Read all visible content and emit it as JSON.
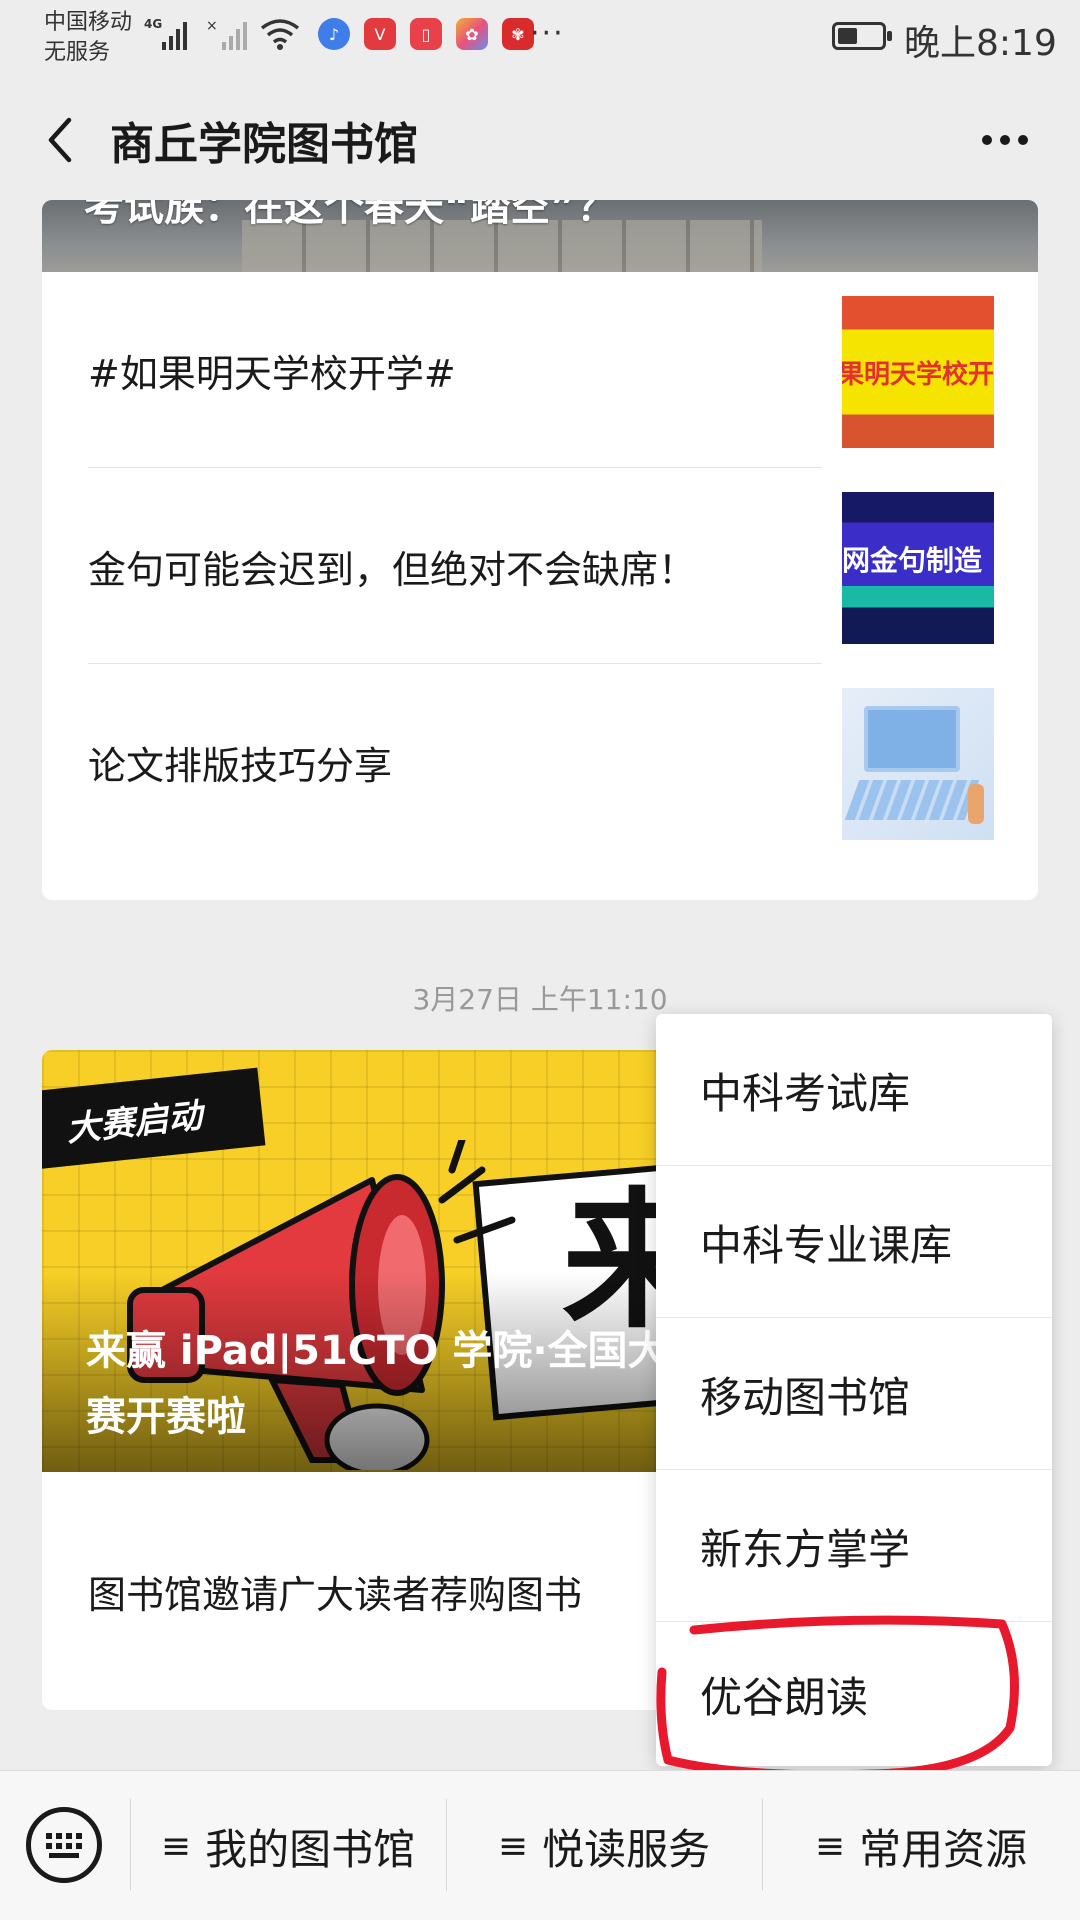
{
  "status_bar": {
    "carrier_line1": "中国移动",
    "carrier_line2": "无服务",
    "network": "4G",
    "time": "晚上8:19",
    "battery_level": 0.45,
    "overflow": "···",
    "app_icons": [
      "music-app-icon",
      "vmall-app-icon",
      "reader-app-icon",
      "gallery-app-icon",
      "huawei-app-icon"
    ]
  },
  "nav": {
    "title": "商丘学院图书馆"
  },
  "article_card_1": {
    "hero_title": "考试族：在这个春天“踏空”？",
    "items": [
      {
        "title": "#如果明天学校开学#",
        "thumb_text": "果明天学校开"
      },
      {
        "title": "金句可能会迟到，但绝对不会缺席！",
        "thumb_text": "网金句制造"
      },
      {
        "title": "论文排版技巧分享"
      }
    ]
  },
  "timestamp": "3月27日 上午11:10",
  "article_card_2": {
    "badge": "大赛启动",
    "hero_title": "来赢 iPad|51CTO 学院·全国大学生…赛开赛啦",
    "hero_title_line1": "来赢 iPad|51CTO 学院·全国大",
    "hero_title_line2": "赛开赛啦",
    "panel_char": "来",
    "items": [
      {
        "title": "图书馆邀请广大读者荐购图书"
      }
    ]
  },
  "popup_menu": {
    "items": [
      "中科考试库",
      "中科专业课库",
      "移动图书馆",
      "新东方掌学",
      "优谷朗读"
    ],
    "highlighted_item": "优谷朗读",
    "highlight_color": "#e8192c"
  },
  "bottom_menu": {
    "keyboard_icon": "keyboard-icon",
    "items": [
      "我的图书馆",
      "悦读服务",
      "常用资源"
    ],
    "item_icon": "≡"
  },
  "colors": {
    "background": "#ededed",
    "card": "#ffffff",
    "hero2_yellow": "#f7cf26",
    "megaphone_red": "#e23a3f"
  }
}
